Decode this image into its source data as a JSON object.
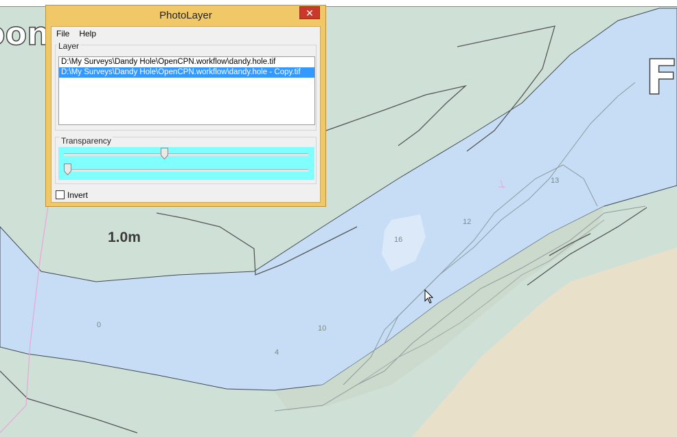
{
  "window": {
    "title": "PhotoLayer",
    "close_glyph": "✕"
  },
  "menu": {
    "file": "File",
    "help": "Help"
  },
  "layer": {
    "label": "Layer",
    "items": [
      {
        "text": "D:\\My Surveys\\Dandy Hole\\OpenCPN.workflow\\dandy.hole.tif",
        "selected": false
      },
      {
        "text": "D:\\My Surveys\\Dandy Hole\\OpenCPN.workflow\\dandy.hole - Copy.tif",
        "selected": true
      }
    ]
  },
  "transparency": {
    "label": "Transparency",
    "slider1_value": 0.41,
    "slider2_value": 0.0
  },
  "invert": {
    "label": "Invert",
    "checked": false
  },
  "chart": {
    "depth_note": "1.0m",
    "soundings": [
      "0",
      "4",
      "10",
      "12",
      "13",
      "16"
    ],
    "partial_label_left": "oon",
    "partial_label_right": "Fo"
  },
  "colors": {
    "land": "#cfe0d6",
    "water": "#c6ddf5",
    "sand": "#e9e0c9",
    "dialog_frame": "#f0c868",
    "selection": "#3399ff",
    "slider_bg": "#80ffff"
  }
}
